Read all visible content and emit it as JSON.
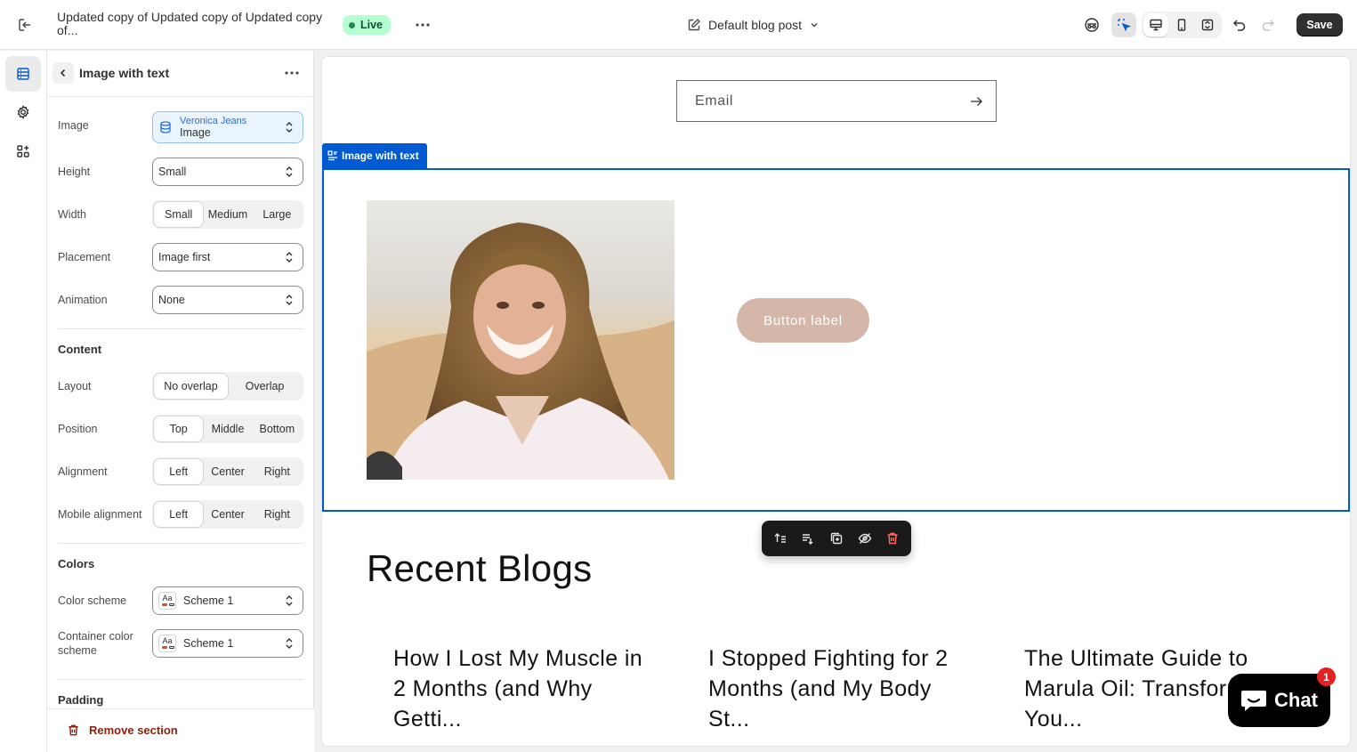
{
  "topbar": {
    "title": "Updated copy of Updated copy of Updated copy of...",
    "status": "Live",
    "template": "Default blog post",
    "save_label": "Save"
  },
  "panel": {
    "title": "Image with text",
    "fields": {
      "image_label": "Image",
      "image_source": "Veronica Jeans",
      "image_value": "Image",
      "height_label": "Height",
      "height_value": "Small",
      "width_label": "Width",
      "width_options": [
        "Small",
        "Medium",
        "Large"
      ],
      "width_selected": "Small",
      "placement_label": "Placement",
      "placement_value": "Image first",
      "animation_label": "Animation",
      "animation_value": "None"
    },
    "content": {
      "title": "Content",
      "layout_label": "Layout",
      "layout_options": [
        "No overlap",
        "Overlap"
      ],
      "position_label": "Position",
      "position_options": [
        "Top",
        "Middle",
        "Bottom"
      ],
      "alignment_label": "Alignment",
      "alignment_options": [
        "Left",
        "Center",
        "Right"
      ],
      "mobile_alignment_label": "Mobile alignment",
      "mobile_alignment_options": [
        "Left",
        "Center",
        "Right"
      ]
    },
    "colors": {
      "title": "Colors",
      "scheme_label": "Color scheme",
      "scheme_value": "Scheme 1",
      "container_label": "Container color scheme",
      "container_value": "Scheme 1",
      "swatch_text": "Aa"
    },
    "padding_title": "Padding",
    "remove_label": "Remove section"
  },
  "preview": {
    "email_placeholder": "Email",
    "section_tag": "Image with text",
    "button_label": "Button label",
    "blogs_title": "Recent Blogs",
    "blogs": [
      "How I Lost My Muscle in 2 Months (and Why Getti...",
      "I Stopped Fighting for 2 Months (and My Body St...",
      "The Ultimate Guide to Marula Oil: Transform You..."
    ],
    "chat_label": "Chat",
    "chat_badge": "1"
  },
  "colors": {
    "accent": "#005bd3",
    "live_bg": "#b4fed2",
    "button_bg": "#d4b7a8",
    "danger": "#8e1f0b"
  }
}
